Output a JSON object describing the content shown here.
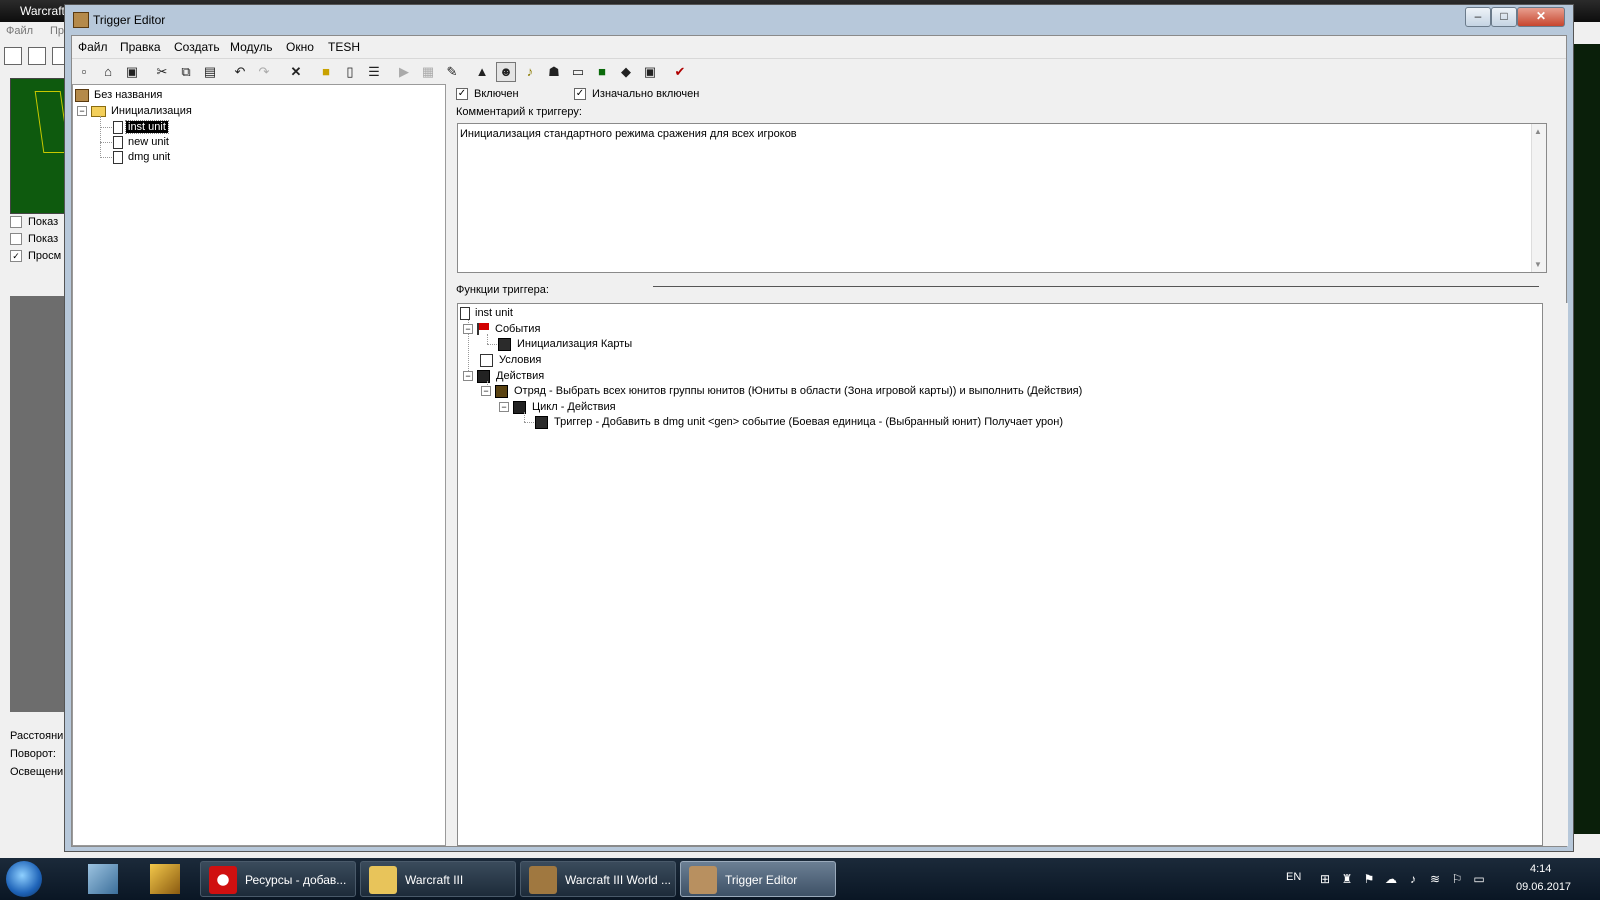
{
  "background_app": {
    "title": "Warcraft",
    "menu": [
      "Файл",
      "Пр"
    ],
    "checkboxes": [
      {
        "label": "Показ",
        "checked": false
      },
      {
        "label": "Показ",
        "checked": false
      },
      {
        "label": "Просм",
        "checked": true
      }
    ],
    "labels": [
      "Расстояни",
      "Поворот:",
      "Освещени"
    ]
  },
  "window": {
    "title": "Trigger Editor",
    "caption_buttons": {
      "minimize": "–",
      "maximize": "□",
      "close": "✕"
    }
  },
  "menu": [
    "Файл",
    "Правка",
    "Создать",
    "Модуль",
    "Окно",
    "TESH"
  ],
  "toolbar_icons": [
    "new-icon",
    "open-icon",
    "save-icon",
    "cut-icon",
    "copy-icon",
    "paste-icon",
    "undo-icon",
    "redo-icon",
    "delete-icon",
    "new-category-icon",
    "new-trigger-icon",
    "new-comment-icon",
    "test-map-icon",
    "disabled-icon",
    "wand-icon",
    "terrain-editor-icon",
    "unit-editor-icon",
    "sound-editor-icon",
    "object-editor-icon",
    "campaign-editor-icon",
    "ai-editor-icon",
    "import-manager-icon",
    "module-icon",
    "export-icon",
    "tesh-icon"
  ],
  "tree": {
    "root": "Без названия",
    "category": "Инициализация",
    "triggers": [
      "inst unit",
      "new unit",
      "dmg unit"
    ],
    "selected": "inst unit"
  },
  "trigger": {
    "enabled_label": "Включен",
    "enabled": true,
    "initially_on_label": "Изначально включен",
    "initially_on": true,
    "comment_label": "Комментарий к триггеру:",
    "comment": "Инициализация стандартного режима сражения для всех игроков",
    "functions_label": "Функции триггера:",
    "functions": {
      "name": "inst unit",
      "events_label": "События",
      "event": "Инициализация Карты",
      "conditions_label": "Условия",
      "actions_label": "Действия",
      "action": "Отряд - Выбрать всех юнитов группы юнитов (Юниты в области (Зона игровой карты)) и выполнить (Действия)",
      "loop": "Цикл - Действия",
      "sub_action": "Триггер - Добавить в dmg unit <gen> событие (Боевая единица - (Выбранный юнит) Получает урон)"
    }
  },
  "taskbar": {
    "tasks": [
      {
        "label": "Ресурсы - добав...",
        "icon": "opera-icon"
      },
      {
        "label": "Warcraft III",
        "icon": "folder-icon"
      },
      {
        "label": "Warcraft III World ...",
        "icon": "world-editor-icon"
      },
      {
        "label": "Trigger Editor",
        "icon": "trigger-editor-icon",
        "active": true
      }
    ],
    "lang": "EN",
    "time": "4:14",
    "date": "09.06.2017"
  }
}
